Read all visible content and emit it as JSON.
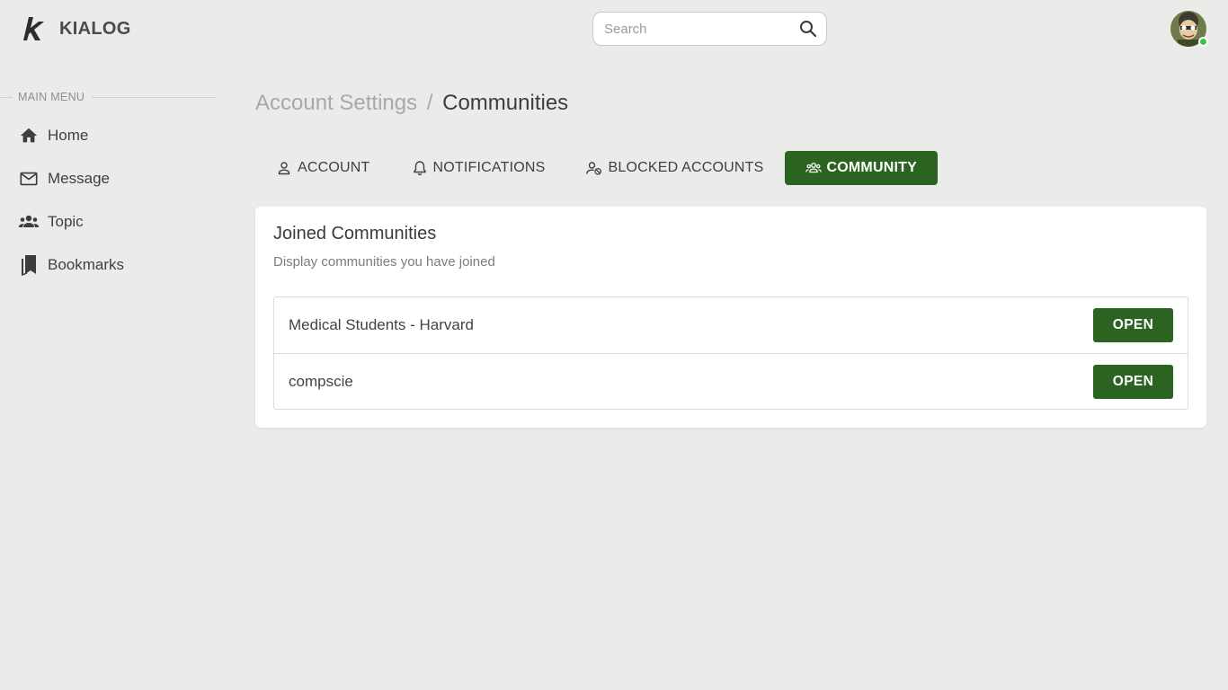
{
  "header": {
    "brand": "KIALOG",
    "search_placeholder": "Search"
  },
  "sidebar": {
    "heading": "MAIN MENU",
    "items": [
      {
        "label": "Home",
        "icon": "home-icon"
      },
      {
        "label": "Message",
        "icon": "mail-icon"
      },
      {
        "label": "Topic",
        "icon": "group-icon"
      },
      {
        "label": "Bookmarks",
        "icon": "bookmarks-icon"
      }
    ]
  },
  "breadcrumb": {
    "parent": "Account Settings",
    "separator": "/",
    "current": "Communities"
  },
  "tabs": [
    {
      "label": "ACCOUNT",
      "icon": "person-icon",
      "active": false
    },
    {
      "label": "NOTIFICATIONS",
      "icon": "bell-icon",
      "active": false
    },
    {
      "label": "BLOCKED ACCOUNTS",
      "icon": "person-blocked-icon",
      "active": false
    },
    {
      "label": "COMMUNITY",
      "icon": "group-icon",
      "active": true
    }
  ],
  "card": {
    "title": "Joined Communities",
    "subtitle": "Display communities you have joined",
    "communities": [
      {
        "name": "Medical Students - Harvard",
        "action": "OPEN"
      },
      {
        "name": "compscie",
        "action": "OPEN"
      }
    ]
  },
  "colors": {
    "accent": "#2b6321",
    "background": "#ebecea",
    "online": "#3ec43e"
  }
}
